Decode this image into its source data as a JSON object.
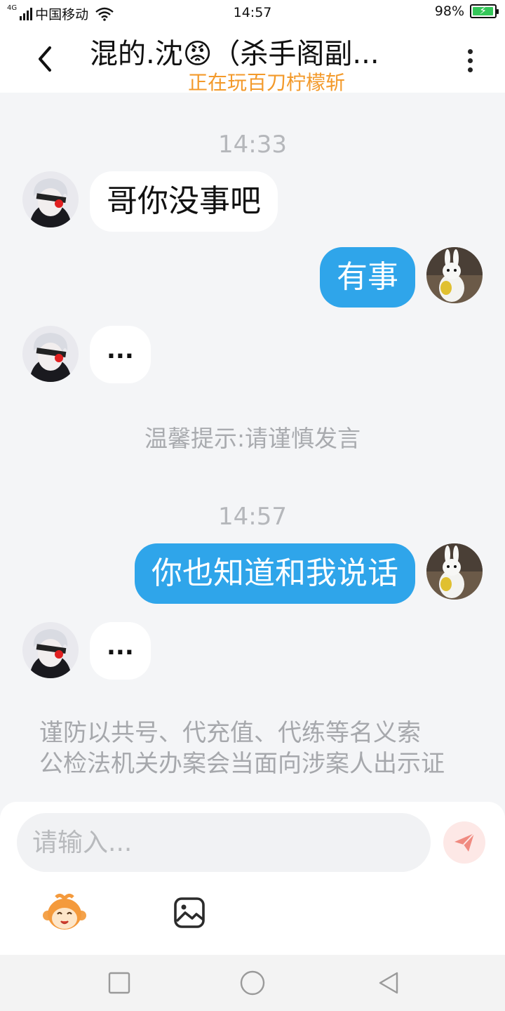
{
  "status_bar": {
    "network": "4G",
    "carrier": "中国移动",
    "time": "14:57",
    "battery_percent_text": "98%",
    "battery_level": 0.98
  },
  "header": {
    "title": "混的.沈😡（杀手阁副...",
    "subtitle": "正在玩百刀柠檬斩"
  },
  "chat": {
    "time_1": "14:33",
    "msg_1": "哥你没事吧",
    "msg_2": "有事",
    "msg_3": "...",
    "hint": "温馨提示:请谨慎发言",
    "time_2": "14:57",
    "msg_4": "你也知道和我说话",
    "msg_5": "...",
    "notice_line_1": "谨防以共号、代充值、代练等名义索",
    "notice_line_2": "公检法机关办案会当面向涉案人出示证"
  },
  "input": {
    "placeholder": "请输入..."
  },
  "colors": {
    "accent_blue": "#2fa5ea",
    "subtitle_orange": "#f39a2b",
    "send_red": "#f08a80"
  },
  "icons": {
    "back": "chevron-left-icon",
    "more": "more-vertical-icon",
    "send": "paper-plane-icon",
    "emoji": "monkey-emoji-icon",
    "image": "image-icon",
    "recents": "square-icon",
    "home": "circle-icon",
    "back_nav": "triangle-back-icon"
  }
}
